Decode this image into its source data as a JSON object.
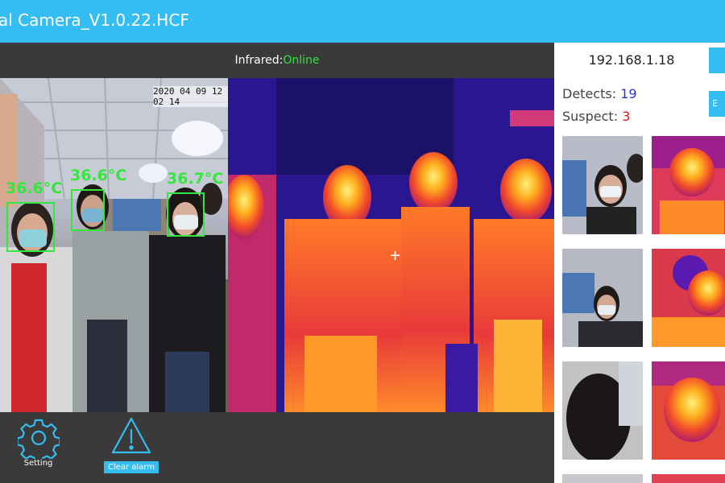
{
  "window": {
    "title": "al Camera_V1.0.22.HCF"
  },
  "status": {
    "label": "Infrared:",
    "value": "Online"
  },
  "visible_feed": {
    "timestamp": "2020 04 09 12 02 14",
    "detections": [
      {
        "temperature": "36.6°C"
      },
      {
        "temperature": "36.6°C"
      },
      {
        "temperature": "36.7°C"
      }
    ]
  },
  "thermal_feed": {
    "crosshair": "+"
  },
  "toolbar": {
    "setting_label": "Setting",
    "clear_alarm_label": "Clear alarm"
  },
  "sidebar": {
    "ip_address": "192.168.1.18",
    "button_top_label": "",
    "button_second_label": "E",
    "detects_label": "Detects:",
    "detects_count": "19",
    "suspect_label": "Suspect:",
    "suspect_count": "3"
  },
  "colors": {
    "accent": "#33bdf1",
    "online": "#2ee63a",
    "detect_box": "#33e83a",
    "suspect_count": "#e2161a",
    "detects_count": "#2a35c8"
  }
}
